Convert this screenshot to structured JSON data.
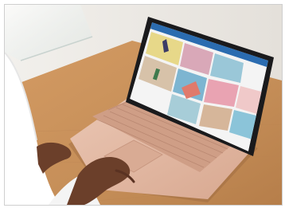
{
  "photo": {
    "subject": "laptop-on-wooden-desk",
    "colors": {
      "wall": "#eeebe6",
      "table": "#c58e58",
      "laptop_body": "#e2b7a1",
      "bezel": "#1a1a1c",
      "screen_bg": "#f4f4f4",
      "app_bar": "#2b6cb0",
      "sleeve": "#ffffff",
      "skin": "#6b3f2a"
    },
    "tiles": [
      {
        "color": "#e7d889",
        "icon": "person-jumping-photo"
      },
      {
        "color": "#d9a8b8",
        "icon": "portrait-photo"
      },
      {
        "color": "#8bc4d9",
        "icon": "architecture-photo"
      },
      {
        "color": "#d7c2a9",
        "icon": "cactus-photo"
      },
      {
        "color": "#7db5d1",
        "icon": "arches-photo"
      },
      {
        "color": "#e9a3b2",
        "icon": "flowers-photo"
      },
      {
        "color": "#f0c9c9",
        "icon": "pink-building-photo"
      },
      {
        "color": "#9ac7d8",
        "icon": "sky-photo"
      },
      {
        "color": "#d6b69a",
        "icon": "mosaic-photo"
      }
    ]
  }
}
